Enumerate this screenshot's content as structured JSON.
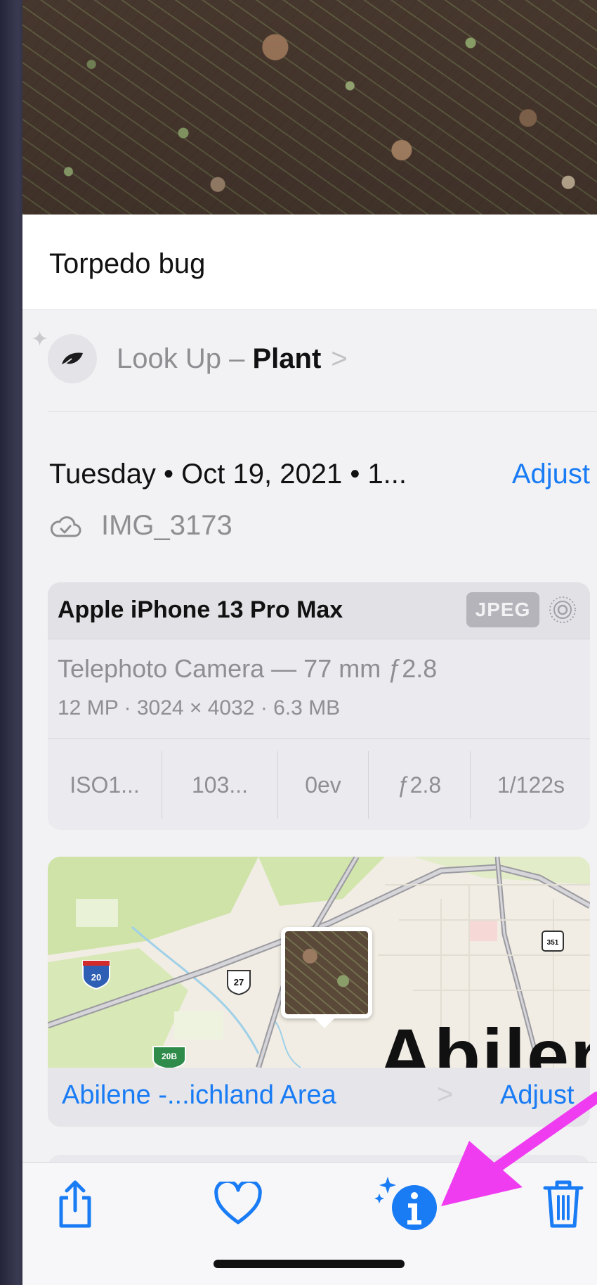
{
  "photo": {
    "caption": "Torpedo bug"
  },
  "lookup": {
    "prefix": "Look Up – ",
    "subject": "Plant",
    "chevron": ">"
  },
  "date": {
    "text": "Tuesday • Oct 19, 2021 • 1...",
    "adjust_label": "Adjust"
  },
  "file": {
    "name": "IMG_3173",
    "icon": "icloud-check-icon"
  },
  "camera": {
    "model": "Apple iPhone 13 Pro Max",
    "format_badge": "JPEG",
    "lens": "Telephoto Camera — 77 mm ƒ2.8",
    "specs": "12 MP · 3024 × 4032 · 6.3 MB",
    "exif": [
      "ISO1...",
      "103...",
      "0ev",
      "ƒ2.8",
      "1/122s"
    ]
  },
  "map": {
    "city_label": "Abilen",
    "location_label": "Abilene -...ichland Area",
    "adjust_label": "Adjust",
    "chevron": ">",
    "shields": [
      "20",
      "27",
      "351",
      "20B"
    ]
  },
  "toolbar": {
    "icons": [
      "share-icon",
      "heart-icon",
      "visual-lookup-info-icon",
      "trash-icon"
    ]
  },
  "colors": {
    "accent": "#1a7cf5",
    "annotation_arrow": "#f03cf0"
  }
}
